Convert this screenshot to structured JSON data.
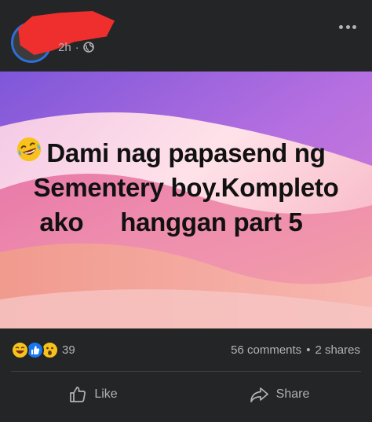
{
  "header": {
    "time": "2h",
    "separator": "·",
    "privacy_icon": "globe-icon",
    "menu_icon": "more-options-icon"
  },
  "post": {
    "caption_lines": [
      "Dami nag papasend ng",
      "Sementery boy.Kompleto",
      "ako",
      "hanggan part 5"
    ],
    "emoji": "face-with-tears-of-joy"
  },
  "reactions": {
    "icons": [
      "haha-reaction-icon",
      "like-reaction-icon",
      "wow-reaction-icon"
    ],
    "count": "39"
  },
  "engagement": {
    "comments": "56 comments",
    "separator": "•",
    "shares": "2 shares"
  },
  "actions": {
    "like_label": "Like",
    "share_label": "Share"
  },
  "colors": {
    "background": "#242526",
    "secondary_text": "#b0b3b8",
    "avatar_ring": "#2d6fd8",
    "redaction": "#ef2e2e"
  }
}
